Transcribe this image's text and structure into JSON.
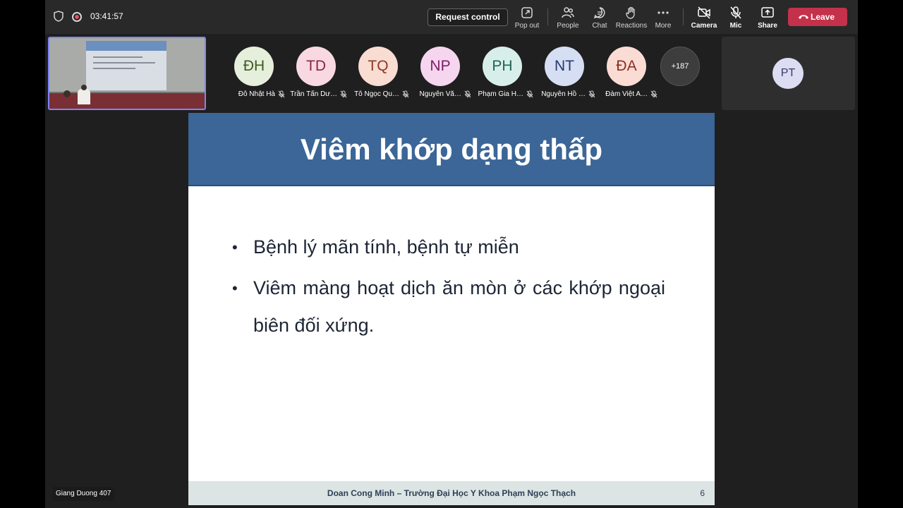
{
  "topbar": {
    "timer": "03:41:57",
    "request_control": "Request control",
    "pop_out": "Pop out",
    "people": "People",
    "chat": "Chat",
    "reactions": "Reactions",
    "more": "More",
    "camera": "Camera",
    "mic": "Mic",
    "share": "Share",
    "leave": "Leave"
  },
  "participants": [
    {
      "initials": "ĐH",
      "name": "Đỗ Nhật Hà",
      "bg": "#e5efdb",
      "fg": "#3f5a21"
    },
    {
      "initials": "TD",
      "name": "Trần Tấn Dư…",
      "bg": "#f8d9e2",
      "fg": "#8a2447"
    },
    {
      "initials": "TQ",
      "name": "Tô Ngọc Qu…",
      "bg": "#f9dcd2",
      "fg": "#8a3a22"
    },
    {
      "initials": "NP",
      "name": "Nguyễn Vă…",
      "bg": "#f6d6ef",
      "fg": "#7a1f66"
    },
    {
      "initials": "PH",
      "name": "Phạm Gia H…",
      "bg": "#d8efe9",
      "fg": "#1f6453"
    },
    {
      "initials": "NT",
      "name": "Nguyễn Hồ …",
      "bg": "#d6def3",
      "fg": "#233a74"
    },
    {
      "initials": "ĐA",
      "name": "Đàm Việt A…",
      "bg": "#fbdcd4",
      "fg": "#8c2d1f"
    }
  ],
  "more_count": "+187",
  "side_tile": {
    "initials": "PT"
  },
  "slide": {
    "title": "Viêm khớp dạng thấp",
    "bullets": [
      "Bệnh lý mãn tính, bệnh tự miễn",
      "Viêm màng hoạt dịch ăn mòn ở các khớp ngoại biên đối xứng."
    ],
    "footer": "Doan Cong Minh – Trường Đại Học Y Khoa Phạm Ngọc Thạch",
    "page": "6"
  },
  "presenter_label": "Giang Duong 407",
  "colors": {
    "leave": "#c4314b",
    "slide_header": "#3b6697",
    "thumb_border": "#7f85f5"
  }
}
